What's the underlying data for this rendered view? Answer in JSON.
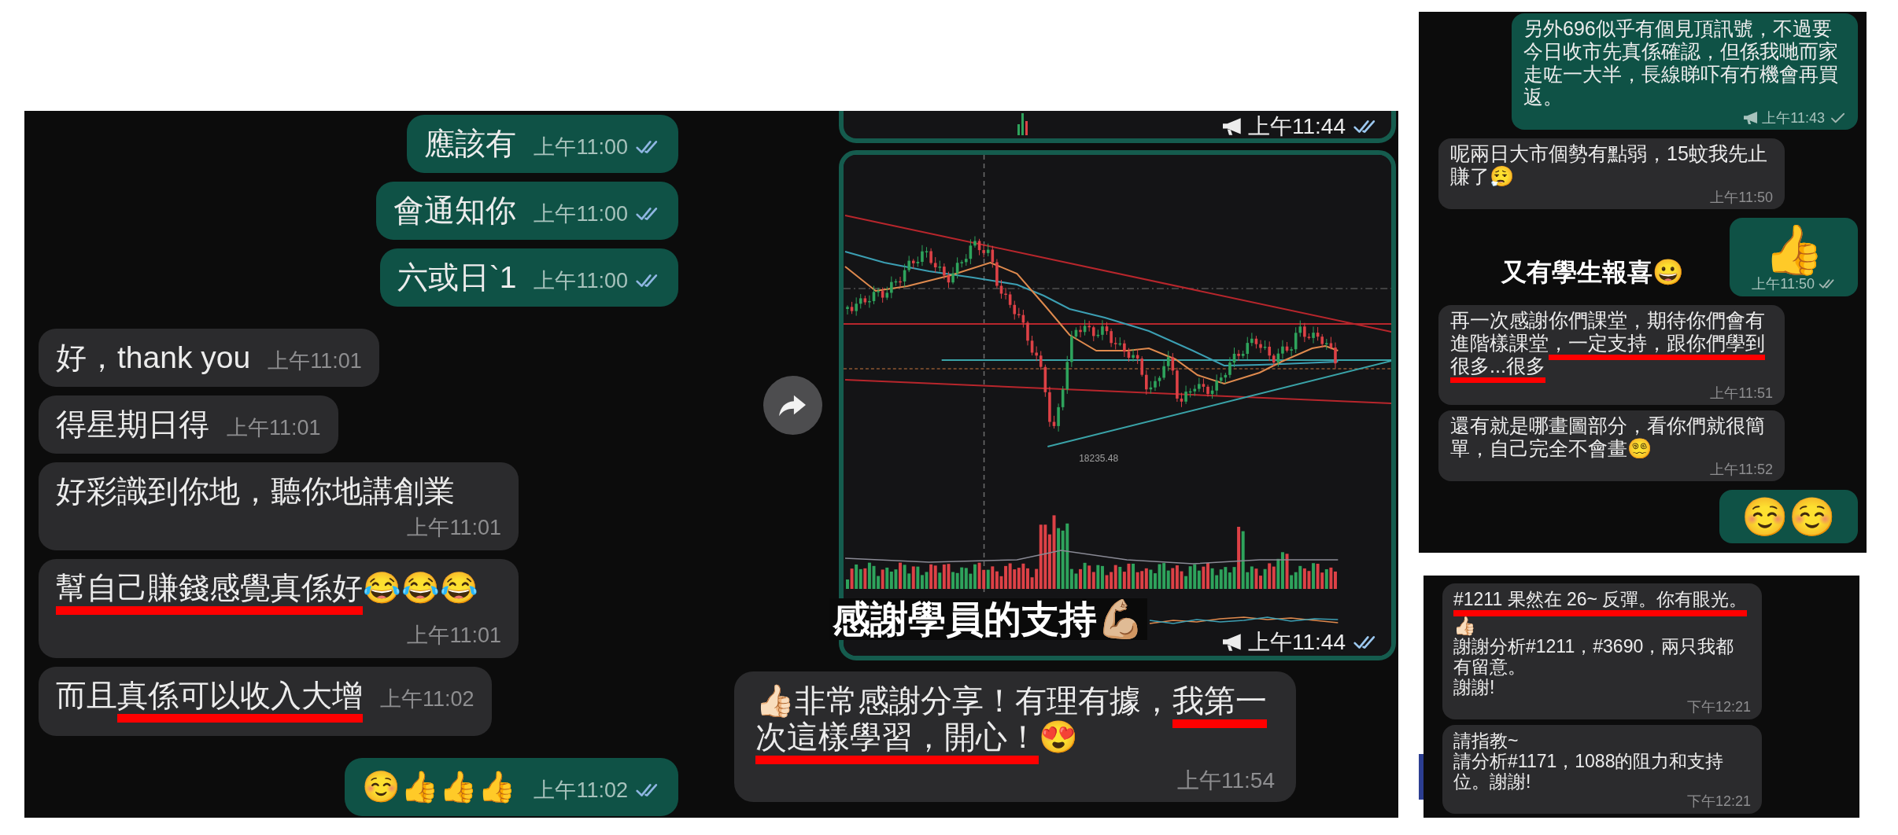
{
  "left_chat": {
    "messages": [
      {
        "kind": "text",
        "outgoing": true,
        "paragraphs": [
          [
            {
              "text": "應該有",
              "underlined": false
            }
          ]
        ],
        "time": "上午11:00",
        "delivered": true,
        "read": true
      },
      {
        "kind": "text",
        "outgoing": true,
        "paragraphs": [
          [
            {
              "text": "會通知你",
              "underlined": false
            }
          ]
        ],
        "time": "上午11:00",
        "delivered": true,
        "read": true
      },
      {
        "kind": "text",
        "outgoing": true,
        "paragraphs": [
          [
            {
              "text": "六或日`1",
              "underlined": false
            }
          ]
        ],
        "time": "上午11:00",
        "delivered": true,
        "read": true
      },
      {
        "kind": "text",
        "outgoing": false,
        "paragraphs": [
          [
            {
              "text": "好，thank you",
              "underlined": false
            }
          ]
        ],
        "time": "上午11:01"
      },
      {
        "kind": "text",
        "outgoing": false,
        "paragraphs": [
          [
            {
              "text": "得星期日得",
              "underlined": false
            }
          ]
        ],
        "time": "上午11:01"
      },
      {
        "kind": "text",
        "outgoing": false,
        "paragraphs": [
          [
            {
              "text": "好彩識到你地，聽你地講創業",
              "underlined": false
            }
          ]
        ],
        "time": "上午11:01"
      },
      {
        "kind": "text",
        "outgoing": false,
        "paragraphs": [
          [
            {
              "text": "幫自己賺錢感覺真係好",
              "underlined": true
            },
            {
              "text": "😂😂😂",
              "underlined": false
            }
          ]
        ],
        "time": "上午11:01"
      },
      {
        "kind": "text",
        "outgoing": false,
        "paragraphs": [
          [
            {
              "text": "而且",
              "underlined": false
            },
            {
              "text": "真係可以收入大增",
              "underlined": true
            }
          ]
        ],
        "time": "上午11:02"
      },
      {
        "kind": "text",
        "outgoing": true,
        "paragraphs": [
          [
            {
              "text": "☺️👍👍👍",
              "underlined": false
            }
          ]
        ],
        "time": "上午11:02",
        "delivered": true,
        "read": true
      }
    ]
  },
  "middle_chat": {
    "messages": [
      {
        "kind": "image_cut",
        "outgoing": true,
        "time": "上午11:44",
        "delivered": true,
        "read": true,
        "broadcast": true
      },
      {
        "kind": "image",
        "outgoing": true,
        "forward_button": true,
        "price_label": "18235.48",
        "time": "上午11:44",
        "delivered": true,
        "read": true,
        "broadcast": true
      },
      {
        "kind": "text",
        "outgoing": false,
        "paragraphs": [
          [
            {
              "text": "👍🏻非常感謝分享！有理有據，",
              "underlined": false
            },
            {
              "text": "我第一次這樣學習，開心！",
              "underlined": true
            },
            {
              "text": "😍",
              "underlined": false
            }
          ]
        ],
        "time": "上午11:54"
      }
    ],
    "annotation": "感謝學員的支持💪🏼"
  },
  "right_top_chat": {
    "messages": [
      {
        "kind": "text",
        "outgoing": true,
        "paragraphs": [
          [
            {
              "text": "另外696似乎有個見頂訊號，不過要今日收市先真係確認，但係我哋而家走咗一大半，長線睇吓有冇機會再買返。",
              "underlined": false
            }
          ]
        ],
        "time": "上午11:43",
        "delivered": false,
        "read": false,
        "broadcast": true
      },
      {
        "kind": "text",
        "outgoing": false,
        "paragraphs": [
          [
            {
              "text": "呢兩日大市個勢有點弱，15蚊我先止賺了😮‍💨",
              "underlined": false
            }
          ]
        ],
        "time": "上午11:50"
      },
      {
        "kind": "emoji",
        "outgoing": true,
        "paragraphs": [
          [
            {
              "text": "👍",
              "underlined": false
            }
          ]
        ],
        "time": "上午11:50",
        "delivered": true,
        "read": false
      },
      {
        "kind": "text",
        "outgoing": false,
        "paragraphs": [
          [
            {
              "text": "再一次感謝你們課堂，期待你們會有進階樣課堂",
              "underlined": false
            },
            {
              "text": "，一定支持，跟你們學到很多...很多",
              "underlined": true
            }
          ]
        ],
        "time": "上午11:51"
      },
      {
        "kind": "text",
        "outgoing": false,
        "paragraphs": [
          [
            {
              "text": "還有就是哪畫圖部分，看你們就很簡單，自己完全不會畫😵‍💫",
              "underlined": false
            }
          ]
        ],
        "time": "上午11:52"
      },
      {
        "kind": "emoji",
        "outgoing": true,
        "paragraphs": [
          [
            {
              "text": "☺️☺️",
              "underlined": false
            }
          ]
        ]
      }
    ],
    "annotation": "又有學生報喜😀"
  },
  "right_bottom_chat": {
    "messages": [
      {
        "kind": "text",
        "outgoing": false,
        "paragraphs": [
          [
            {
              "text": "#1211 果然在 26~ 反彈。你有眼光。",
              "underlined": true
            }
          ],
          [
            {
              "text": "👍🏻",
              "underlined": false
            }
          ],
          [
            {
              "text": "謝謝分析#1211，#3690，兩只我都有留意。",
              "underlined": false
            }
          ],
          [
            {
              "text": "謝謝!",
              "underlined": false
            }
          ]
        ],
        "time": "下午12:21"
      },
      {
        "kind": "text",
        "outgoing": false,
        "paragraphs": [
          [
            {
              "text": "請指教~",
              "underlined": false
            }
          ],
          [
            {
              "text": "請分析#1171，1088的阻力和支持位。謝謝!",
              "underlined": false
            }
          ]
        ],
        "time": "下午12:21"
      }
    ]
  }
}
